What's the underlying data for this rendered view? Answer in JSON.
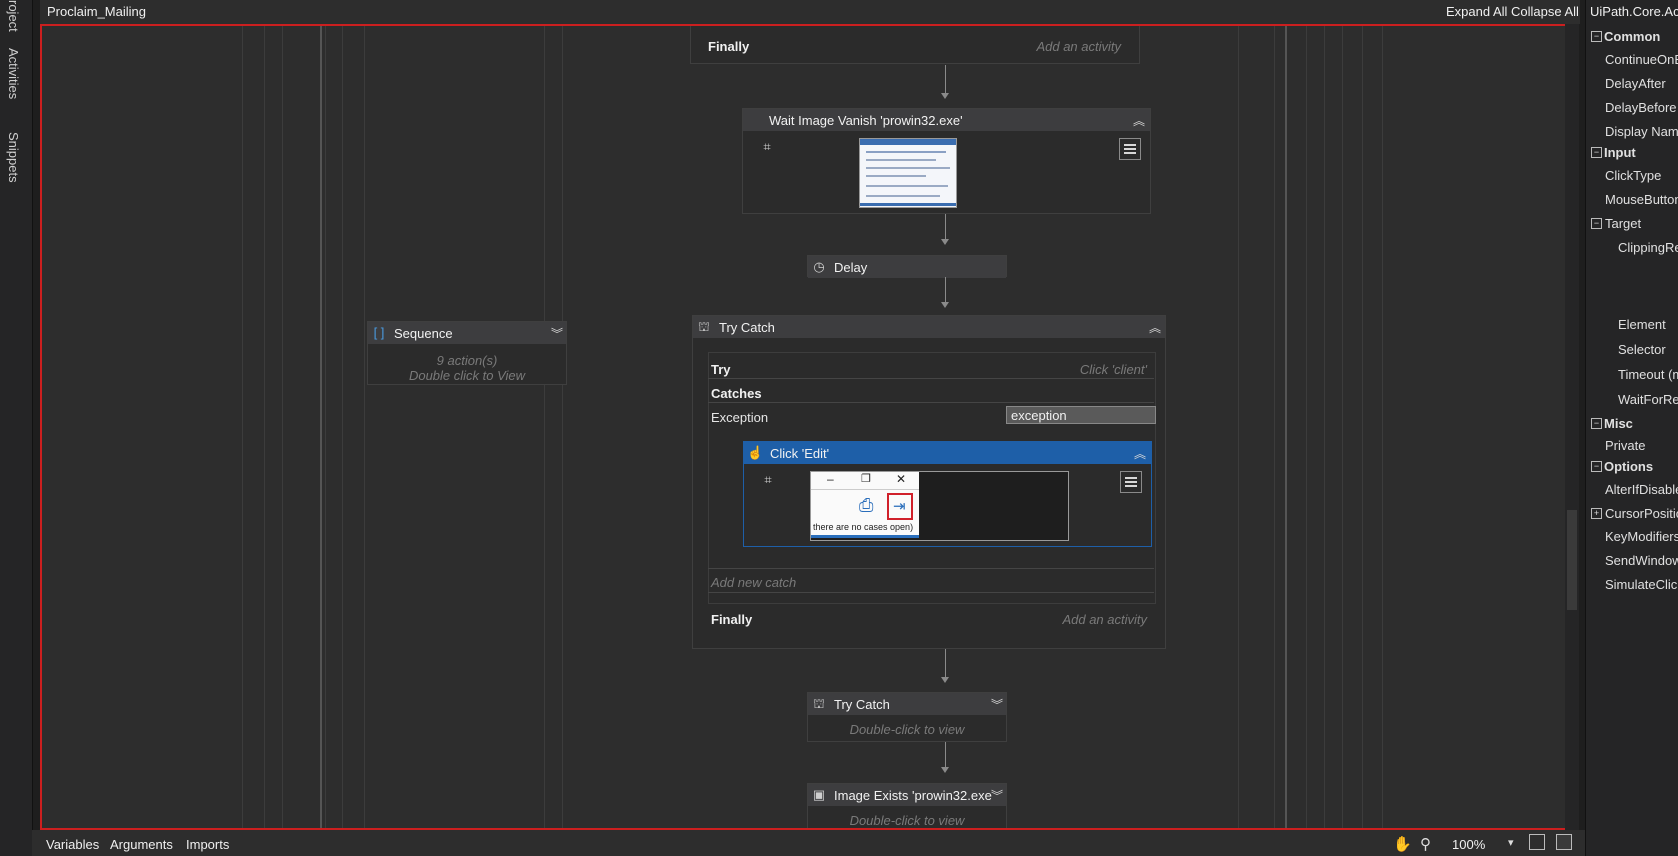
{
  "left_tabs": [
    "roject",
    "Activities",
    "Snippets"
  ],
  "designer": {
    "title": "Proclaim_Mailing",
    "expand_all": "Expand All",
    "collapse_all": "Collapse All"
  },
  "sequence": {
    "title": "Sequence",
    "count": "9 action(s)",
    "hint": "Double click to View"
  },
  "top_finally": {
    "label": "Finally",
    "hint": "Add an activity"
  },
  "wait_image": {
    "title": "Wait Image Vanish 'prowin32.exe'"
  },
  "delay": {
    "title": "Delay"
  },
  "try_catch": {
    "title": "Try Catch",
    "try_label": "Try",
    "try_hint": "Click 'client'",
    "catches_label": "Catches",
    "exception_label": "Exception",
    "exception_var": "exception",
    "add_new_catch": "Add new catch",
    "finally_label": "Finally",
    "finally_hint": "Add an activity"
  },
  "click_edit": {
    "title": "Click 'Edit'",
    "preview_caption": "there are no cases open)"
  },
  "try_catch_2": {
    "title": "Try Catch",
    "hint": "Double-click to view"
  },
  "image_exists": {
    "title": "Image Exists 'prowin32.exe",
    "hint": "Double-click to view"
  },
  "properties": {
    "title": "UiPath.Core.Activ",
    "rows": [
      {
        "label": "Common",
        "category": true
      },
      {
        "label": "ContinueOnEr"
      },
      {
        "label": "DelayAfter"
      },
      {
        "label": "DelayBefore"
      },
      {
        "label": "Display Name"
      },
      {
        "label": "Input",
        "category": true
      },
      {
        "label": "ClickType"
      },
      {
        "label": "MouseButton"
      },
      {
        "label": "Target"
      },
      {
        "label": "ClippingReg"
      },
      {
        "label": "Element"
      },
      {
        "label": "Selector"
      },
      {
        "label": "Timeout (m"
      },
      {
        "label": "WaitForRea"
      },
      {
        "label": "Misc",
        "category": true
      },
      {
        "label": "Private"
      },
      {
        "label": "Options",
        "category": true
      },
      {
        "label": "AlterIfDisable"
      },
      {
        "label": "CursorPosition"
      },
      {
        "label": "KeyModifiers"
      },
      {
        "label": "SendWindowl"
      },
      {
        "label": "SimulateClick"
      }
    ]
  },
  "bottom_tabs": {
    "variables": "Variables",
    "arguments": "Arguments",
    "imports": "Imports"
  },
  "zoom": "100%",
  "colors": {
    "accent_blue": "#1e5fa8",
    "highlight_red": "#cc1f1f"
  }
}
